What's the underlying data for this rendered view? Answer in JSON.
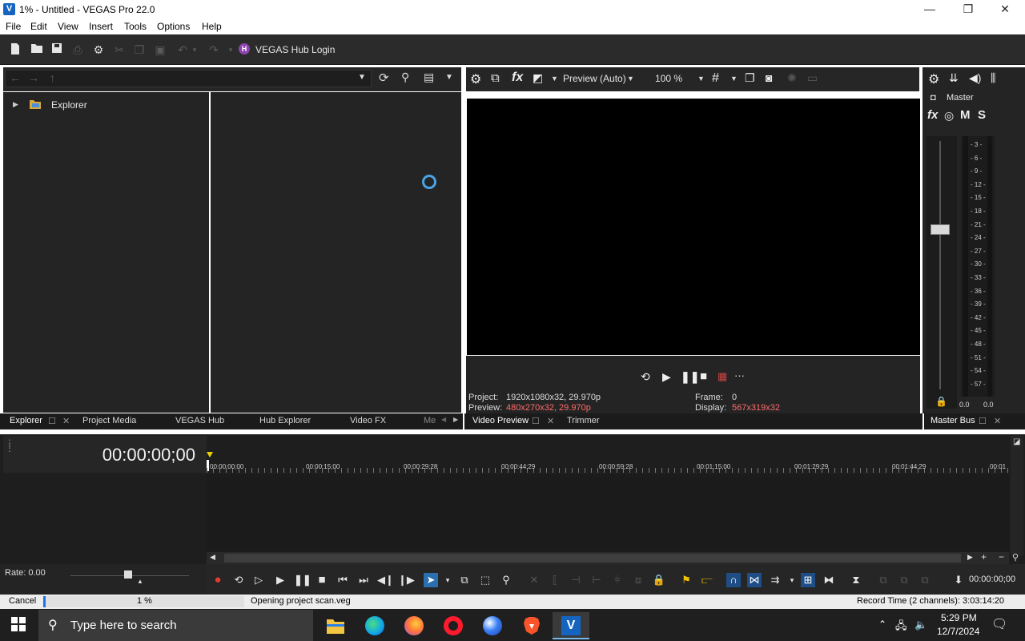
{
  "window": {
    "logo": "V",
    "title": "1% - Untitled - VEGAS Pro 22.0",
    "minimize": "—",
    "maximize": "❐",
    "close": "✕"
  },
  "menu": [
    "File",
    "Edit",
    "View",
    "Insert",
    "Tools",
    "Options",
    "Help"
  ],
  "toolbar": {
    "hub_icon": "H",
    "hub_login": "VEGAS Hub Login"
  },
  "explorer": {
    "tree_item": "Explorer"
  },
  "left_tabs": [
    "Explorer",
    "Project Media",
    "VEGAS Hub",
    "Hub Explorer",
    "Video FX",
    "Me"
  ],
  "preview": {
    "mode": "Preview (Auto)",
    "zoom": "100 %",
    "project_label": "Project:",
    "project_value": "1920x1080x32, 29.970p",
    "preview_label": "Preview:",
    "preview_value": "480x270x32, 29.970p",
    "frame_label": "Frame:",
    "frame_value": "0",
    "display_label": "Display:",
    "display_value": "567x319x32"
  },
  "mid_tabs": [
    "Video Preview",
    "Trimmer"
  ],
  "master": {
    "label": "Master",
    "buttons": [
      "fx",
      "M",
      "S"
    ],
    "scale": [
      "3",
      "6",
      "9",
      "12",
      "15",
      "18",
      "21",
      "24",
      "27",
      "30",
      "33",
      "36",
      "39",
      "42",
      "45",
      "48",
      "51",
      "54",
      "57"
    ],
    "left_level": "0.0",
    "right_level": "0.0",
    "tab": "Master Bus"
  },
  "timeline": {
    "timecode": "00:00:00;00",
    "ruler": [
      "00:00:00;00",
      "00:00:15;00",
      "00:00:29;28",
      "00:00:44;29",
      "00:00:59;28",
      "00:01:15;00",
      "00:01:29;29",
      "00:01:44;29",
      "00:01"
    ],
    "rate": "Rate: 0.00",
    "end_time": "00:00:00;00"
  },
  "status": {
    "cancel": "Cancel",
    "percent": "1 %",
    "progress": 0.01,
    "message": "Opening project scan.veg",
    "record_time": "Record Time (2 channels): 3:03:14:20"
  },
  "taskbar": {
    "search_placeholder": "Type here to search",
    "time": "5:29 PM",
    "date": "12/7/2024",
    "apps": [
      "file-explorer",
      "edge",
      "firefox",
      "opera",
      "app-blue",
      "brave",
      "vegas"
    ]
  },
  "colors": {
    "accent": "#1565c0",
    "playhead": "#e8d200",
    "record": "#e53935",
    "highlight": "#ff6b6b"
  }
}
